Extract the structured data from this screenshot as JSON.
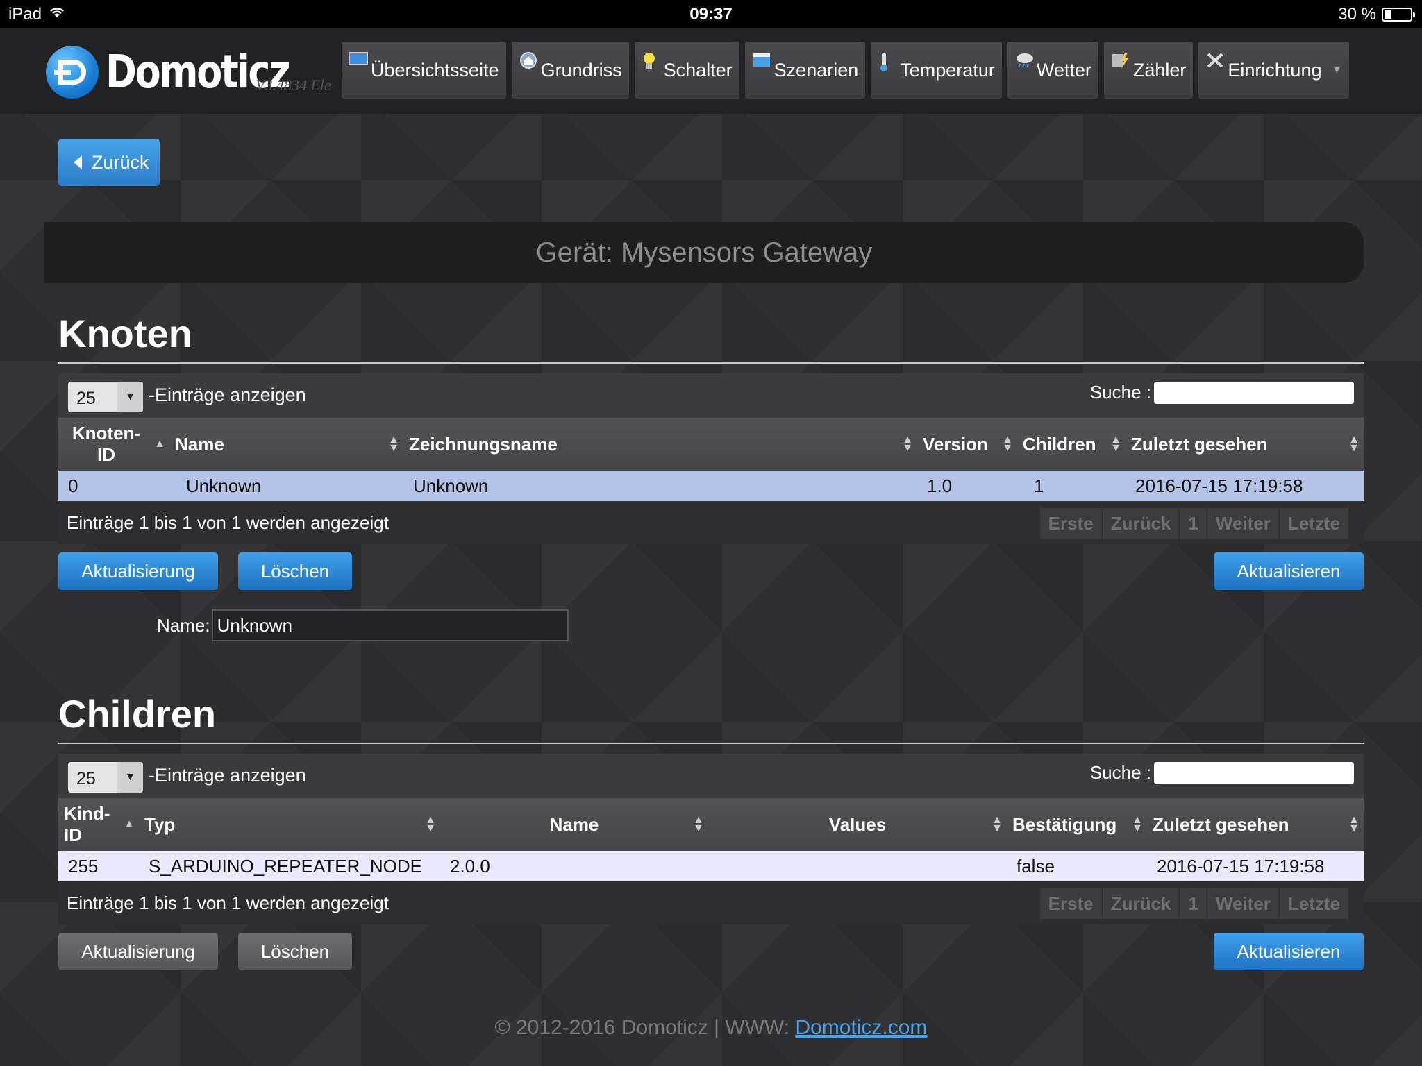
{
  "statusbar": {
    "device": "iPad",
    "time": "09:37",
    "battery_text": "30 %",
    "battery_level": 0.3
  },
  "app": {
    "logo_text": "Domoticz",
    "version": "V3.4834 Ele"
  },
  "nav": [
    {
      "label": "Übersichtsseite",
      "icon": "overview-icon"
    },
    {
      "label": "Grundriss",
      "icon": "floorplan-icon"
    },
    {
      "label": "Schalter",
      "icon": "lightbulb-icon"
    },
    {
      "label": "Szenarien",
      "icon": "clapperboard-icon"
    },
    {
      "label": "Temperatur",
      "icon": "thermometer-icon"
    },
    {
      "label": "Wetter",
      "icon": "weather-icon"
    },
    {
      "label": "Zähler",
      "icon": "meter-icon"
    },
    {
      "label": "Einrichtung",
      "icon": "tools-icon"
    }
  ],
  "back_button": "Zurück",
  "device_banner": "Gerät: Mysensors Gateway",
  "nodes": {
    "title": "Knoten",
    "length_value": "25",
    "length_label": "-Einträge anzeigen",
    "search_label": "Suche :",
    "headers": [
      "Knoten-ID",
      "Name",
      "Zeichnungsname",
      "Version",
      "Children",
      "Zuletzt gesehen"
    ],
    "rows": [
      {
        "id": "0",
        "name": "Unknown",
        "sketch": "Unknown",
        "version": "1.0",
        "children": "1",
        "last_seen": "2016-07-15 17:19:58"
      }
    ],
    "info": "Einträge 1 bis 1 von 1 werden angezeigt",
    "pager": [
      "Erste",
      "Zurück",
      "1",
      "Weiter",
      "Letzte"
    ],
    "btn_update": "Aktualisierung",
    "btn_delete": "Löschen",
    "btn_refresh": "Aktualisieren",
    "name_label": "Name:",
    "name_value": "Unknown"
  },
  "children": {
    "title": "Children",
    "length_value": "25",
    "length_label": "-Einträge anzeigen",
    "search_label": "Suche :",
    "headers": [
      "Kind-ID",
      "Typ",
      "Name",
      "Values",
      "Bestätigung",
      "Zuletzt gesehen"
    ],
    "rows": [
      {
        "id": "255",
        "type": "S_ARDUINO_REPEATER_NODE",
        "name": "2.0.0",
        "values": "",
        "ack": "false",
        "last_seen": "2016-07-15 17:19:58"
      }
    ],
    "info": "Einträge 1 bis 1 von 1 werden angezeigt",
    "pager": [
      "Erste",
      "Zurück",
      "1",
      "Weiter",
      "Letzte"
    ],
    "btn_update": "Aktualisierung",
    "btn_delete": "Löschen",
    "btn_refresh": "Aktualisieren"
  },
  "footer": {
    "text": "© 2012-2016 Domoticz | WWW: ",
    "link": "Domoticz.com"
  },
  "colors": {
    "accent": "#2b7dc9",
    "selected_row": "#b5c3e8",
    "light_row": "#eae9ff"
  }
}
